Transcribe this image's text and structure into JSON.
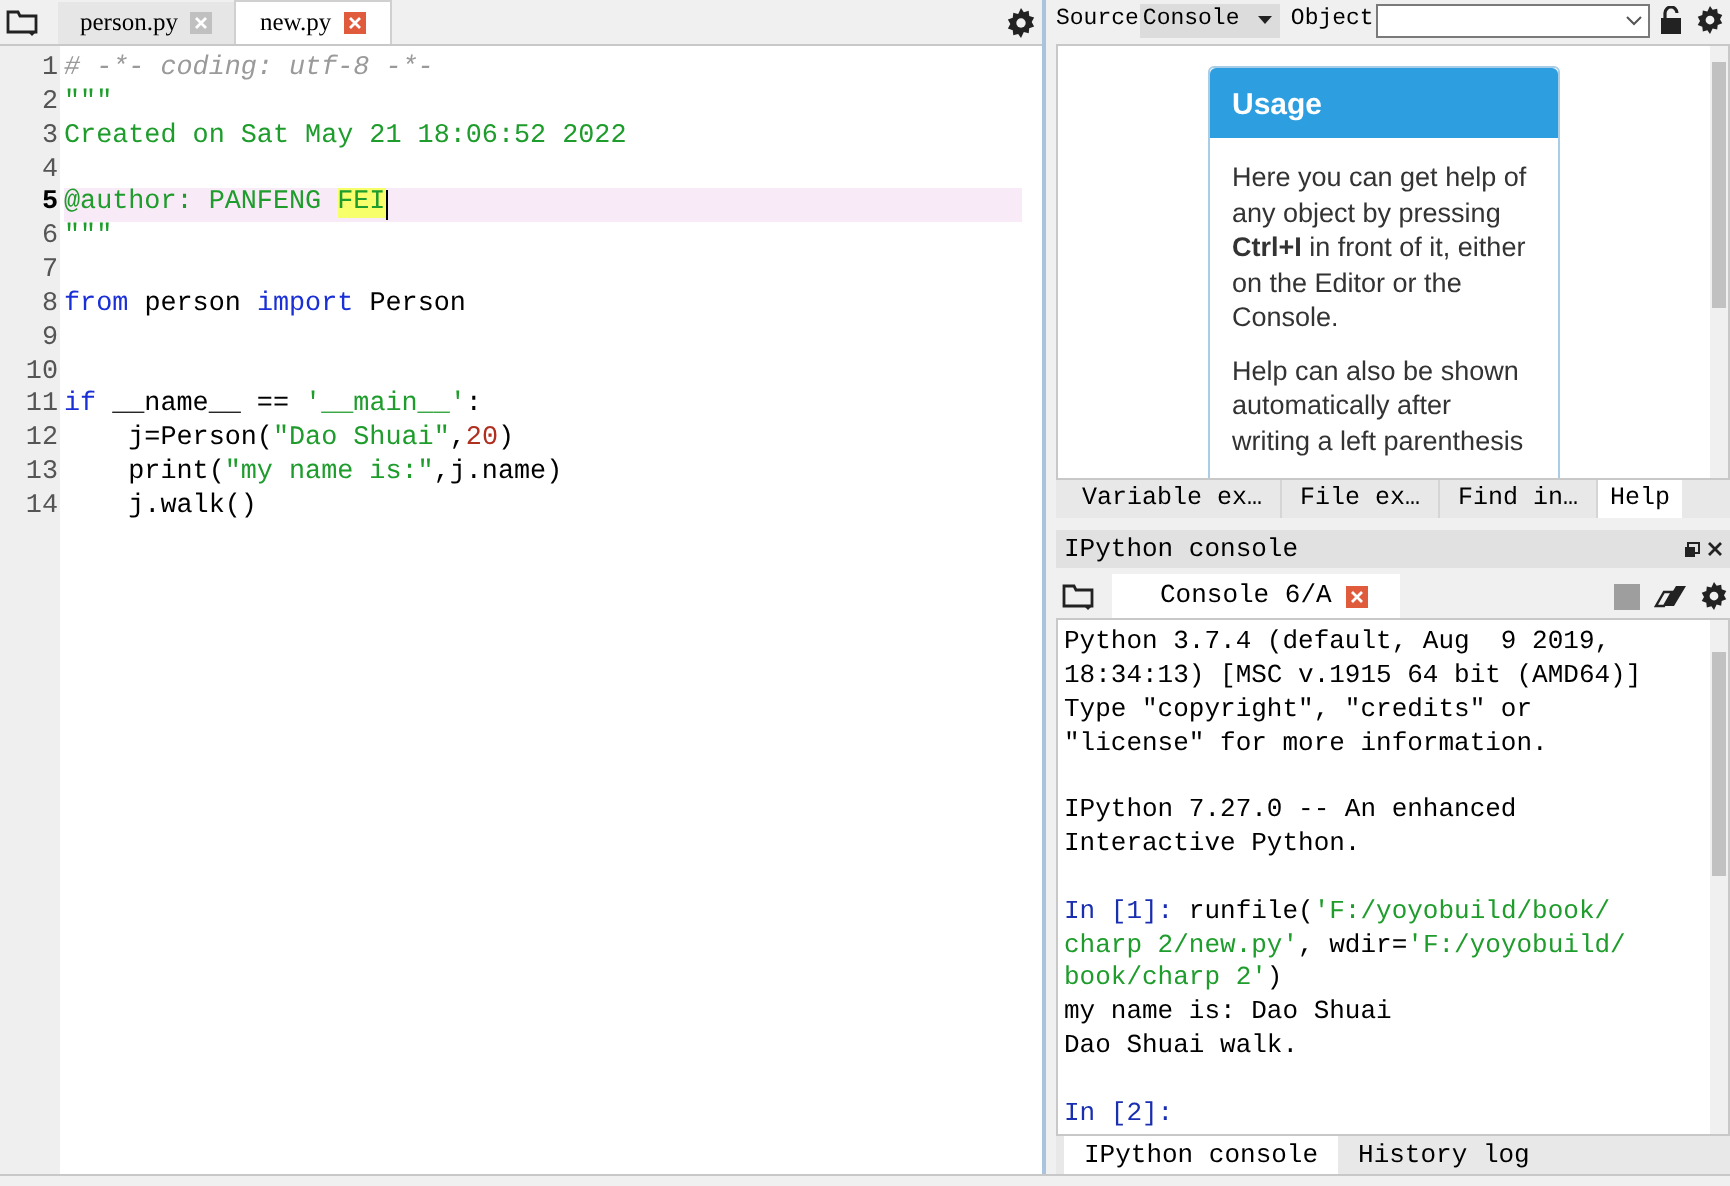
{
  "editor": {
    "tabs": [
      {
        "label": "person.py",
        "selected": false
      },
      {
        "label": "new.py",
        "selected": true
      }
    ],
    "lines": [
      {
        "number": "1",
        "current": false,
        "tokens": [
          {
            "kind": "comment",
            "text": "# -*- coding: utf-8 -*-"
          }
        ]
      },
      {
        "number": "2",
        "current": false,
        "tokens": [
          {
            "kind": "string",
            "text": "\"\"\""
          }
        ]
      },
      {
        "number": "3",
        "current": false,
        "tokens": [
          {
            "kind": "string",
            "text": "Created on Sat May 21 18:06:52 2022"
          }
        ]
      },
      {
        "number": "4",
        "current": false
      },
      {
        "number": "5",
        "current": true,
        "tokens": [
          {
            "kind": "string",
            "text": "@author: PANFENG "
          },
          {
            "kind": "match",
            "text": "FEI"
          }
        ]
      },
      {
        "number": "6",
        "current": false,
        "tokens": [
          {
            "kind": "string",
            "text": "\"\"\""
          }
        ]
      },
      {
        "number": "7",
        "current": false
      },
      {
        "number": "8",
        "current": false,
        "tokens": [
          {
            "kind": "keyword",
            "text": "from"
          },
          {
            "kind": "plain",
            "text": " person "
          },
          {
            "kind": "keyword",
            "text": "import"
          },
          {
            "kind": "plain",
            "text": " Person"
          }
        ]
      },
      {
        "number": "9",
        "current": false
      },
      {
        "number": "10",
        "current": false
      },
      {
        "number": "11",
        "current": false,
        "tokens": [
          {
            "kind": "keyword",
            "text": "if"
          },
          {
            "kind": "plain",
            "text": " __name__ == "
          },
          {
            "kind": "string",
            "text": "'__main__'"
          },
          {
            "kind": "plain",
            "text": ":"
          }
        ]
      },
      {
        "number": "12",
        "current": false,
        "tokens": [
          {
            "kind": "plain",
            "text": "    j=Person("
          },
          {
            "kind": "string",
            "text": "\"Dao Shuai\""
          },
          {
            "kind": "plain",
            "text": ","
          },
          {
            "kind": "number",
            "text": "20"
          },
          {
            "kind": "plain",
            "text": ")"
          }
        ]
      },
      {
        "number": "13",
        "current": false,
        "tokens": [
          {
            "kind": "plain",
            "text": "    print("
          },
          {
            "kind": "string",
            "text": "\"my name is:\""
          },
          {
            "kind": "plain",
            "text": ",j.name)"
          }
        ]
      },
      {
        "number": "14",
        "current": false,
        "tokens": [
          {
            "kind": "plain",
            "text": "    j.walk()"
          }
        ]
      }
    ]
  },
  "help": {
    "source_label": "Source",
    "source_value": "Console",
    "object_label": "Object",
    "card": {
      "title": "Usage",
      "paragraphs": [
        "Here you can get help of any object by pressing **Ctrl+I** in front of it, either on the Editor or the Console.",
        "Help can also be shown automatically after writing a left parenthesis"
      ]
    },
    "tabs": [
      {
        "label": "Variable ex…",
        "selected": false
      },
      {
        "label": "File ex…",
        "selected": false
      },
      {
        "label": "Find in…",
        "selected": false
      },
      {
        "label": "Help",
        "selected": true
      }
    ]
  },
  "console": {
    "title": "IPython console",
    "tabs": [
      {
        "label": "Console 6/A",
        "selected": true
      }
    ],
    "lines": [
      {
        "kind": "text",
        "tokens": [
          {
            "kind": "plain",
            "text": "Python 3.7.4 (default, Aug  9 2019,"
          }
        ]
      },
      {
        "kind": "text",
        "tokens": [
          {
            "kind": "plain",
            "text": "18:34:13) [MSC v.1915 64 bit (AMD64)]"
          }
        ]
      },
      {
        "kind": "text",
        "tokens": [
          {
            "kind": "plain",
            "text": "Type \"copyright\", \"credits\" or"
          }
        ]
      },
      {
        "kind": "text",
        "tokens": [
          {
            "kind": "plain",
            "text": "\"license\" for more information."
          }
        ]
      },
      {
        "kind": "blank"
      },
      {
        "kind": "text",
        "tokens": [
          {
            "kind": "plain",
            "text": "IPython 7.27.0 -- An enhanced"
          }
        ]
      },
      {
        "kind": "text",
        "tokens": [
          {
            "kind": "plain",
            "text": "Interactive Python."
          }
        ]
      },
      {
        "kind": "blank"
      },
      {
        "kind": "text",
        "tokens": [
          {
            "kind": "prompt",
            "text": "In [1]:"
          },
          {
            "kind": "plain",
            "text": " runfile("
          },
          {
            "kind": "string",
            "text": "'F:/yoyobuild/book/"
          }
        ]
      },
      {
        "kind": "text",
        "tokens": [
          {
            "kind": "string",
            "text": "charp 2/new.py'"
          },
          {
            "kind": "plain",
            "text": ", wdir="
          },
          {
            "kind": "string",
            "text": "'F:/yoyobuild/"
          }
        ]
      },
      {
        "kind": "text",
        "tokens": [
          {
            "kind": "string",
            "text": "book/charp 2'"
          },
          {
            "kind": "plain",
            "text": ")"
          }
        ]
      },
      {
        "kind": "text",
        "tokens": [
          {
            "kind": "plain",
            "text": "my name is: Dao Shuai"
          }
        ]
      },
      {
        "kind": "text",
        "tokens": [
          {
            "kind": "plain",
            "text": "Dao Shuai walk."
          }
        ]
      },
      {
        "kind": "blank"
      },
      {
        "kind": "text",
        "tokens": [
          {
            "kind": "prompt",
            "text": "In [2]:"
          }
        ]
      }
    ],
    "bottom_tabs": [
      {
        "label": "IPython console",
        "selected": true
      },
      {
        "label": "History log",
        "selected": false
      }
    ]
  }
}
